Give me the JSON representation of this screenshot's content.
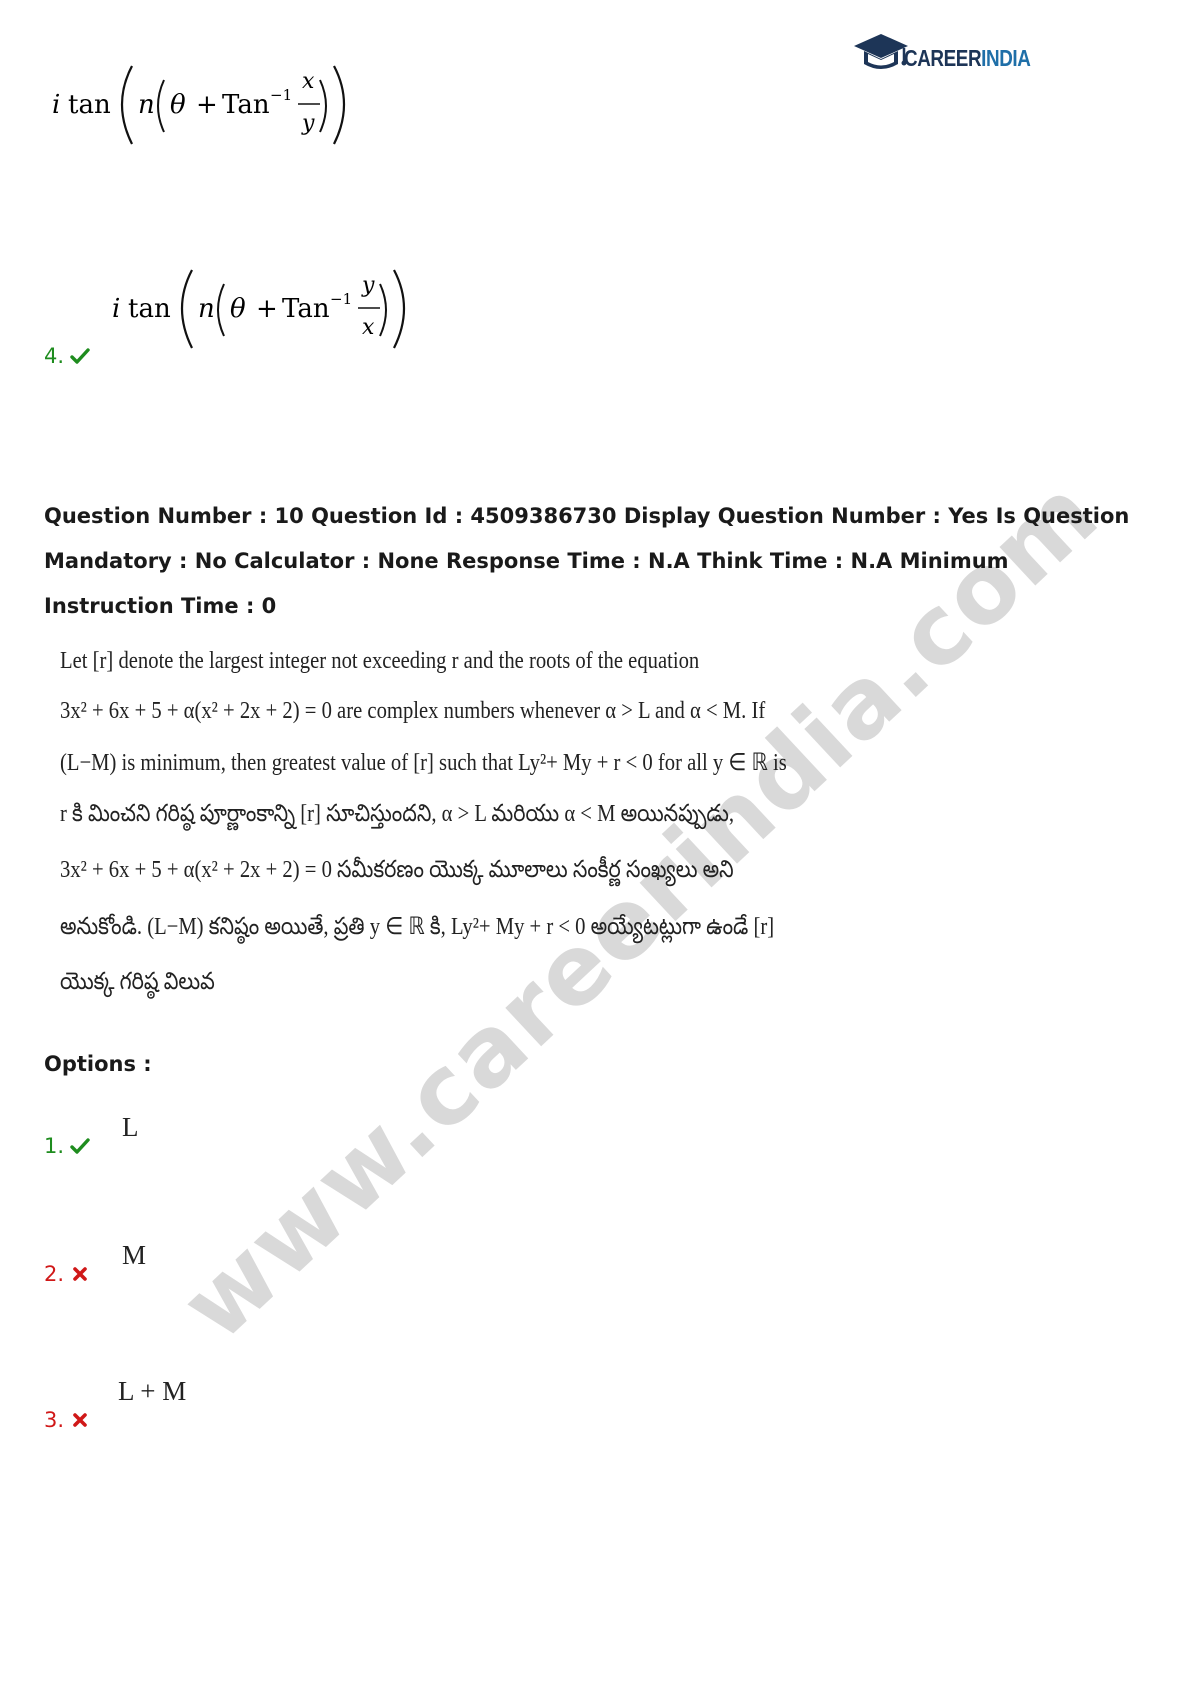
{
  "logo": {
    "text_part1": "CAREER",
    "text_part2": "INDIA",
    "icon": "graduation-cap-icon"
  },
  "previous_options": {
    "option3_formula": {
      "prefix": "i tan",
      "inner": "n",
      "theta": "θ",
      "plus": "+",
      "func": "Tan",
      "power": "−1",
      "numerator": "x",
      "denominator": "y"
    },
    "option4": {
      "number": "4.",
      "status_icon": "check-icon",
      "formula": {
        "prefix": "i tan",
        "inner": "n",
        "theta": "θ",
        "plus": "+",
        "func": "Tan",
        "power": "−1",
        "numerator": "y",
        "denominator": "x"
      }
    }
  },
  "question": {
    "header": "Question Number : 10 Question Id : 4509386730 Display Question Number : Yes Is Question Mandatory : No Calculator : None Response Time : N.A Think Time : N.A Minimum Instruction Time : 0",
    "lines": [
      "Let [r] denote the largest integer not exceeding r and the roots of the equation",
      "3x² + 6x + 5 + α(x² + 2x + 2) = 0  are  complex  numbers  whenever  α > L  and  α < M.  If",
      "(L−M) is minimum, then greatest value of [r] such that Ly²+ My + r < 0 for all y ∈ ℝ is",
      "r కి మించని గరిష్ఠ పూర్ణాంకాన్ని [r] సూచిస్తుందని, α > L మరియు α < M అయినప్పుడు,",
      "3x² + 6x + 5 + α(x² + 2x + 2) = 0 సమీకరణం యొక్క మూలాలు సంకీర్ణ సంఖ్యలు అని",
      "అనుకోండి. (L−M) కనిష్ఠం అయితే, ప్రతి y ∈ ℝ కి, Ly²+ My + r < 0 అయ్యేటట్లుగా ఉండే [r]",
      "యొక్క గరిష్ఠ విలువ"
    ]
  },
  "options_label": "Options :",
  "options": [
    {
      "number": "1.",
      "status": "correct",
      "status_icon": "check-icon",
      "value": "L"
    },
    {
      "number": "2.",
      "status": "wrong",
      "status_icon": "cross-icon",
      "value": "M"
    },
    {
      "number": "3.",
      "status": "wrong",
      "status_icon": "cross-icon",
      "value": "L + M"
    }
  ],
  "watermark": "www.careerindia.com",
  "colors": {
    "correct": "#1e8c1e",
    "wrong": "#d01818",
    "logo_dark": "#1d3557",
    "logo_accent": "#1f6fa8",
    "watermark": "#d9d9d9"
  }
}
